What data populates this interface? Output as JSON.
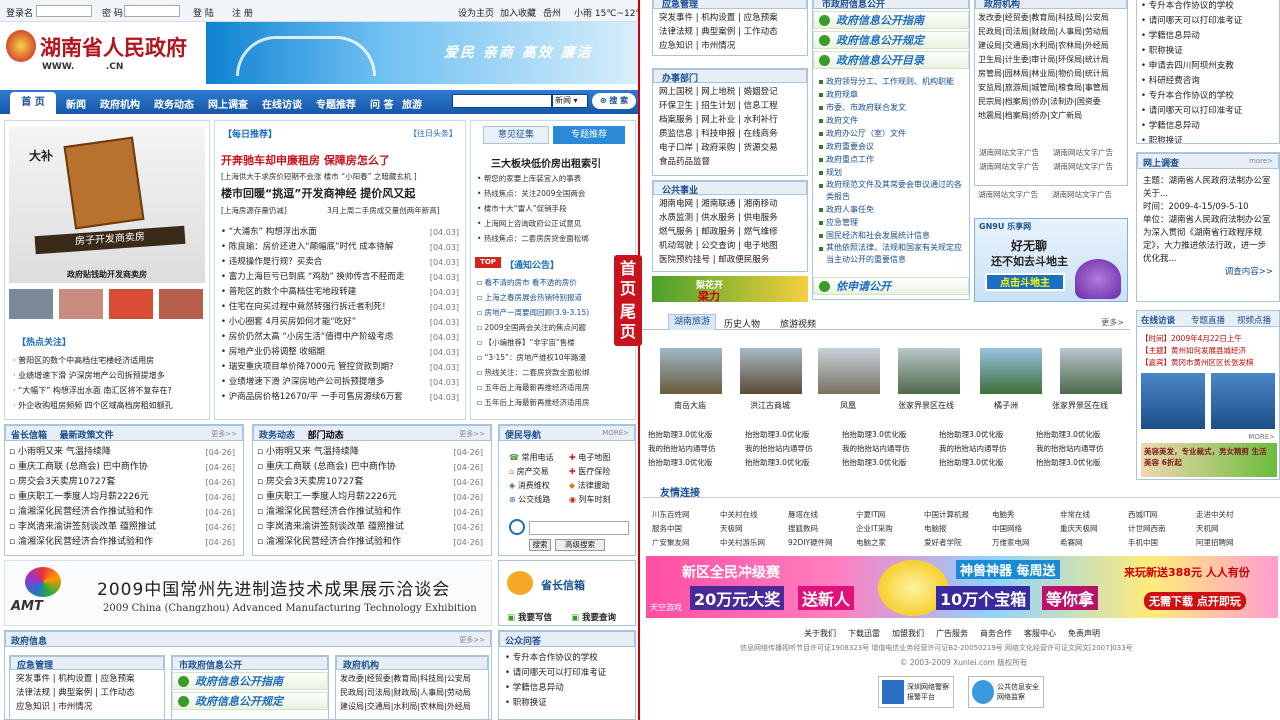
{
  "colors": {
    "accent": "#1b4f91",
    "red": "#c00000",
    "green": "#3a9a2a"
  },
  "login": {
    "user_label": "登录名",
    "pass_label": "密 码",
    "login_btn": "登 陆",
    "register_btn": "注 册",
    "set_home": "设为主页",
    "add_fav": "加入收藏",
    "city": "岳州",
    "weather": "小雨 15℃~12℃"
  },
  "logo": {
    "title": "湖南省人民政府",
    "domain": "WWW.          .CN"
  },
  "banner": {
    "slogan": "爱民  亲商  高效  廉洁"
  },
  "nav": {
    "items": [
      "首 页",
      "新闻",
      "政府机构",
      "政务动态",
      "网上调查",
      "在线访谈",
      "专题推荐",
      "问 答",
      "旅游"
    ],
    "search_select": "新闻",
    "search_btn": "搜 索"
  },
  "feature": {
    "caption": "政府贴钱助开发商卖房",
    "bubble": "大补",
    "board": "房子开发商卖房",
    "hot_title": "【热点关注】",
    "hot_items": [
      "普阳区的数个中高档住宅楼经济适用房",
      "业绩增速下滑 沪深房地产公司拆预提增多",
      "“大幅下” 构想浮出水面 南汇区将不复存在?",
      "外企收购租房频频 四个区域高档房租如额孔"
    ]
  },
  "daily": {
    "title": "【每日推荐】",
    "past": "【往日头条】",
    "headline1": "开奔驰车却申廉租房  保障房怎么了",
    "sub1": "[上海供大于求房价短期不会涨  楼市 “小阳春” 之暗藏玄机 ]",
    "headline2": "楼市回暖“挑逗”开发商神经  提价风又起",
    "sub2_left": "[上海房源存量仍减]",
    "sub2_right": "3月上周二手房成交量创两年新高]",
    "items": [
      [
        "“大浦东” 构想浮出水面",
        "[04.03]"
      ],
      [
        "陈良瑜：房价还进入“颠幅底”时代  成本待解",
        "[04.03]"
      ],
      [
        "违规操作是行规？买卖合",
        "[04.03]"
      ],
      [
        "富力上海巨亏已到底 “鸡肋” 换帅传言不胫而走",
        "[04.03]"
      ],
      [
        "普陀区的数个中高档住宅地段转建",
        "[04.03]"
      ],
      [
        "住宅在向买过程中竟然转强行拆迁者利死！",
        "[04.03]"
      ],
      [
        "小心圈套 4月买房如何才能“吃好”",
        "[04.03]"
      ],
      [
        "房价仍然太高 “小房生活”值得中产阶级考虑",
        "[04.03]"
      ],
      [
        "房地产业仍将调整  收缩期",
        "[04.03]"
      ],
      [
        "瑞安重庆项目单价降7000元 管控贷款到期?",
        "[04.03]"
      ],
      [
        "业绩增速下滑 沪深房地产公司拆预提增多",
        "[04.03]"
      ],
      [
        "沪商品房价格12670/平 一手可售房源续6万套",
        "[04.03]"
      ]
    ]
  },
  "opinion": {
    "tab1": "意见征集",
    "tab2": "专题推荐",
    "headline": "三大板块低价房出租索引",
    "items": [
      "帮您的家要上库装宜入的事表",
      "热线焦点：关注2009全国两会",
      "楼市十大“雷人”促销手段",
      "上海网上咨询政府公正试意见",
      "热线焦点：二套房房贷金面松绑"
    ],
    "notice_tag": "TOP",
    "notice_title": "【通知公告】",
    "notices": [
      "看不清的房市 看不透的房价",
      "上海之春房展会热销特别报道",
      "房地产一周要闻回顾(3.9-3.15)",
      "2009全国两会关注的焦点问题",
      "【小编推荐】“非宇宙”售楼",
      "“3·15”：房地产维权10年路漫",
      "热线关注：二套房贷款全面松绑",
      "五年后上海最新再推经济适用房",
      "五年后上海最新再推经济适用房"
    ]
  },
  "mid_list": {
    "tab1": "省长信箱",
    "tab2": "最新政策文件",
    "more": "更多>>",
    "items": [
      [
        "小雨明又来 气温持续降",
        "[04-26]"
      ],
      [
        "重庆工商联 (总商会) 巴中商作协",
        "[04-26]"
      ],
      [
        "房交会3天卖房10727套",
        "[04-26]"
      ],
      [
        "重庆职工一季度人均月薪2226元",
        "[04-26]"
      ],
      [
        "渝湘深化民营经济合作推试验和作",
        "[04-26]"
      ],
      [
        "李岚清来渝讲签刻谈改革 蕴照推试",
        "[04-26]"
      ],
      [
        "渝湘深化民营经济合作推试验和作",
        "[04-26]"
      ]
    ]
  },
  "mid_list2": {
    "tab1": "政务动态",
    "tab2": "部门动态",
    "more": "更多>>",
    "items": [
      [
        "小雨明又来 气温持续降",
        "[04-26]"
      ],
      [
        "重庆工商联 (总商会) 巴中商作协",
        "[04-26]"
      ],
      [
        "房交会3天卖房10727套",
        "[04-26]"
      ],
      [
        "重庆职工一季度人均月薪2226元",
        "[04-26]"
      ],
      [
        "渝湘深化民营经济合作推试验和作",
        "[04-26]"
      ],
      [
        "李岚清来渝讲签刻谈改革 蕴照推试",
        "[04-26]"
      ],
      [
        "渝湘深化民营经济合作推试验和作",
        "[04-26]"
      ]
    ]
  },
  "convenience": {
    "title": "便民导航",
    "more": "MORE>",
    "links": [
      "常用电话",
      "电子地图",
      "房产交易",
      "医疗保险",
      "消费维权",
      "法律援助",
      "公交线路",
      "列车时刻"
    ],
    "search_btn": "搜索",
    "adv_btn": "高级搜索"
  },
  "exhibition": {
    "title": "2009中国常州先进制造技术成果展示洽谈会",
    "subtitle": "2009 China (Changzhou) Advanced Manufacturing Technology Exhibition",
    "logo": "AMT"
  },
  "mailbox": {
    "title": "省长信箱",
    "write": "我要写信",
    "query": "我要查询"
  },
  "gov_info": {
    "title": "政府信息",
    "more": "更多>>",
    "emergency_title": "应急管理",
    "emergency_items": [
      "突发事件",
      "机构设置",
      "应急预案",
      "法律法规",
      "典型案例",
      "工作动态",
      "应急知识",
      "市州情况"
    ],
    "public_title": "市政府信息公开",
    "public_secs": [
      "政府信息公开指南",
      "政府信息公开规定",
      "政府信息公开目录"
    ],
    "org_title": "政府机构",
    "org_items": [
      "发改委",
      "经贸委",
      "教育局",
      "科技局",
      "公安局",
      "民政局",
      "司法局",
      "财政局",
      "人事局",
      "劳动局",
      "建设局",
      "交通局",
      "水利局",
      "农林局",
      "外经局"
    ],
    "qa_title": "公众问答",
    "qa_items": [
      "专升本合作协议的学校",
      "请问哪天可以打印准考证",
      "学籍信息异动",
      "职称换证"
    ]
  },
  "r_emergency": {
    "title": "应急管理",
    "items": [
      "突发事件",
      "机构设置",
      "应急预案",
      "法律法规",
      "典型案例",
      "工作动态",
      "应急知识",
      "市州情况"
    ]
  },
  "r_office": {
    "title": "办事部门",
    "items": [
      "网上国税",
      "网上地税",
      "婚姻登记",
      "环保卫生",
      "招生计划",
      "信息工程",
      "档案服务",
      "网上补业",
      "水利补行",
      "质监信息",
      "科技申报",
      "在线商务",
      "电子口岸",
      "政府采购",
      "货源交易",
      "食品药品监督"
    ]
  },
  "r_public": {
    "title": "公共事业",
    "items": [
      "湘南电网",
      "湘南联通",
      "湘南移动",
      "水质监测",
      "供水服务",
      "供电服务",
      "燃气服务",
      "邮政服务",
      "燃气维修",
      "机动驾驶",
      "公交查询",
      "电子地图",
      "医院预约挂号",
      "邮政便民服务"
    ]
  },
  "r_ad": {
    "text1": "梨花开",
    "text2": "梁力"
  },
  "r_pub": {
    "title": "市政府信息公开",
    "secs": [
      "政府信息公开指南",
      "政府信息公开规定",
      "政府信息公开目录"
    ],
    "items": [
      "政府领导分工、工作规则、机构职能",
      "政府规章",
      "市委、市政府联合发文",
      "政府文件",
      "政府办公厅（室）文件",
      "政府重要会议",
      "政府重点工作",
      "规划",
      "政府规范文件及其常委会审议通过的各类报告",
      "政府人事任免",
      "应急管理",
      "国民经济和社会发展统计信息",
      "其他依照法律、法规和国家有关规定应当主动公开的重要信息"
    ],
    "apply": "依申请公开"
  },
  "r_org": {
    "title": "政府机构",
    "items": [
      "发改委",
      "经贸委",
      "教育局",
      "科技局",
      "公安局",
      "民政局",
      "司法局",
      "财政局",
      "人事局",
      "劳动局",
      "建设局",
      "交通局",
      "水利局",
      "农林局",
      "外经局",
      "卫生局",
      "计生委",
      "审计局",
      "环保局",
      "统计局",
      "房管局",
      "园林局",
      "林业局",
      "物价局",
      "统计局",
      "安监局",
      "旅游局",
      "城管局",
      "粮食局",
      "事管局",
      "民宗局",
      "档案局",
      "侨办",
      "法制办",
      "国资委",
      "地震局",
      "档案局",
      "侨办",
      "文广新局"
    ],
    "ads": [
      "湖南网站文字广告",
      "湖南网站文字广告",
      "湖南网站文字广告",
      "湖南网站文字广告",
      "湖南网站文字广告",
      "湖南网站文字广告"
    ]
  },
  "r_game": {
    "brand": "GN9U 乐享网",
    "line1": "好无聊",
    "line2": "还不如去斗地主",
    "btn": "点击斗地主"
  },
  "r_qa": {
    "items": [
      "专升本合作协议的学校",
      "请问哪天可以打印准考证",
      "学籍信息异动",
      "职称换证",
      "申请去四川阿坝州支教",
      "科研经费咨询",
      "专升本合作协议的学校",
      "请问哪天可以打印准考证",
      "学籍信息异动",
      "职称换证"
    ]
  },
  "r_survey": {
    "title": "网上调查",
    "more": "more>",
    "theme": "主题：湖南省人民政府法制办公室关于...",
    "time": "时间：2009-4-15/09-5-10",
    "unit": "单位：湖南省人民政府法制办公室 为深入贯彻《湖南省行政程序规定》，大力推进依法行政，进一步优化我...",
    "more_link": "调查内容>>"
  },
  "r_travel": {
    "tabs": [
      "湖南旅游",
      "历史人物",
      "旅游视频"
    ],
    "more": "更多>",
    "spots": [
      "南岳大庙",
      "洪江古商城",
      "凤凰",
      "张家界景区在线",
      "橘子洲",
      "张家界景区在线"
    ],
    "rolls": [
      "抬抬助理3.0优化版",
      "我的抬抬站内通导仿",
      "抬抬助理3.0优化版"
    ]
  },
  "r_interview": {
    "tabs": [
      "在线访谈",
      "专题直播",
      "视频点播"
    ],
    "time": "【时间】2009年4月22日上午",
    "theme": "【主题】黄州如何发展县城经济",
    "guest": "【嘉宾】黄冈市黄州区区长张发棋",
    "more": "MORE>",
    "ad": "美容美发，专业裁式，男女精剪 生活美容 6折起"
  },
  "friend_links": {
    "title": "友情连接",
    "items": [
      "川东百姓网",
      "中关村在线",
      "雁塔在线",
      "宁夏IT网",
      "中国计算机报",
      "电脑秀",
      "非常在线",
      "西城IT网",
      "走进中关村",
      "服务中国",
      "天极网",
      "搜狐数码",
      "企业IT采购",
      "电脑报",
      "中国网络",
      "重庆天极网",
      "计世网西南",
      "天机网",
      "广安聚友网",
      "中关村游乐网",
      "92DIY硬件网",
      "电脑之家",
      "爱好者学院",
      "万维家电网",
      "希赛网",
      "手机中国",
      "阿里招聘网"
    ]
  },
  "bottom_ad": {
    "tag": "新区全民冲级赛",
    "prize1": "20万元大奖",
    "prize2": "送新人",
    "weekly": "神兽神器 每周送",
    "prize3": "10万个宝箱",
    "prize4": "等你拿",
    "right1": "来玩新送388元 人人有份",
    "right2": "无需下载 点开即玩",
    "site": "天空游戏"
  },
  "footer": {
    "links": [
      "关于我们",
      "下载迅雷",
      "加盟我们",
      "广告服务",
      "商务合作",
      "客服中心",
      "免责声明"
    ],
    "icp": "信息网络传播视听节目许可证1908323号  增值电信业务经营许可证B2-20050219号  网络文化经营许可证文网文[2007]033号",
    "copyright": "© 2003-2009 Xunlei.com 版权所有",
    "badge1": "深圳网络警察报警平台",
    "badge2": "公共信息安全网络监察"
  },
  "divider": {
    "home": "首页",
    "tail": "尾页"
  }
}
